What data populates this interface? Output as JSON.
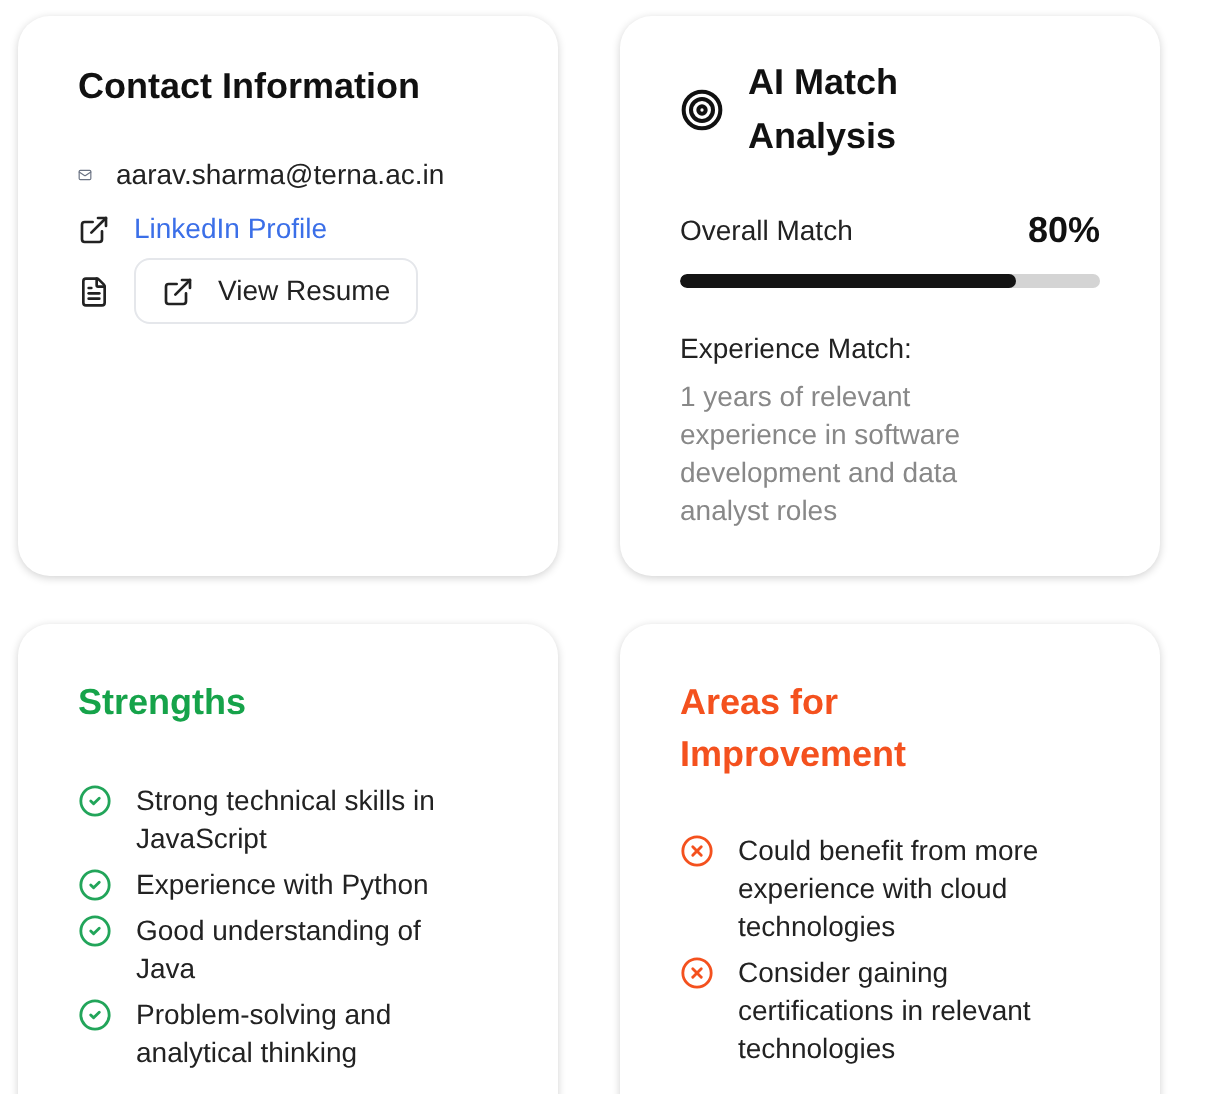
{
  "contact": {
    "title": "Contact Information",
    "email": "aarav.sharma@terna.ac.in",
    "linkedin": "LinkedIn Profile",
    "resume_button": "View Resume"
  },
  "match": {
    "title": "AI Match Analysis",
    "overall_label": "Overall Match",
    "overall_value": "80%",
    "level": 0.8,
    "experience_label": "Experience Match:",
    "experience_text": "1 years of relevant experience in software development and data analyst roles"
  },
  "strengths": {
    "title": "Strengths",
    "items": [
      "Strong technical skills in JavaScript",
      "Experience with Python",
      "Good understanding of Java",
      "Problem-solving and analytical thinking"
    ]
  },
  "improvements": {
    "title": "Areas for Improvement",
    "items": [
      "Could benefit from more experience with cloud technologies",
      "Consider gaining certifications in relevant technologies"
    ]
  }
}
